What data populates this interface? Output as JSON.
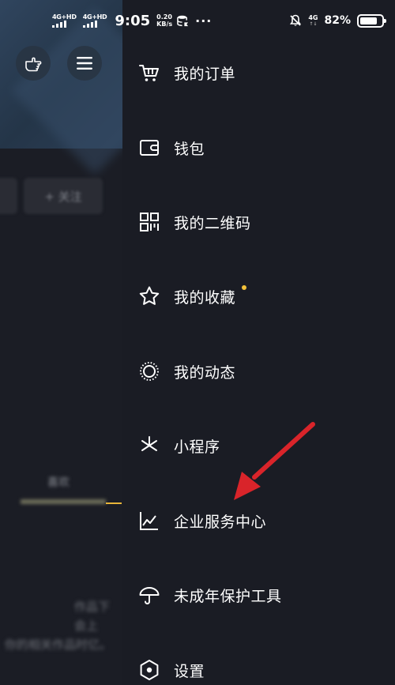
{
  "status_bar": {
    "signal1_tag": "4G+HD",
    "signal2_tag": "4G+HD",
    "time": "9:05",
    "speed_value": "0.20",
    "speed_unit": "KB/s",
    "more": "···",
    "net_type_top": "4G",
    "net_type_bottom": "↑↓",
    "battery_percent": "82%",
    "battery_level": 0.82
  },
  "background_page": {
    "follow_button_label": "+ 关注",
    "tab_label": "喜欢",
    "tab_dim_label": "",
    "blurred_text_line1": "作品下会上",
    "blurred_text_line2": "你的相关作品时亿。"
  },
  "menu": {
    "items": [
      {
        "id": "orders",
        "label": "我的订单",
        "icon": "cart-icon"
      },
      {
        "id": "wallet",
        "label": "钱包",
        "icon": "wallet-icon"
      },
      {
        "id": "qrcode",
        "label": "我的二维码",
        "icon": "qrcode-icon"
      },
      {
        "id": "favorites",
        "label": "我的收藏",
        "icon": "star-icon"
      },
      {
        "id": "moments",
        "label": "我的动态",
        "icon": "dotted-circle-icon"
      },
      {
        "id": "miniprogram",
        "label": "小程序",
        "icon": "asterisk-icon"
      },
      {
        "id": "enterprise",
        "label": "企业服务中心",
        "icon": "line-chart-icon"
      },
      {
        "id": "minor",
        "label": "未成年保护工具",
        "icon": "umbrella-icon"
      },
      {
        "id": "settings",
        "label": "设置",
        "icon": "hexagon-settings-icon"
      }
    ]
  },
  "colors": {
    "drawer_bg": "#1a1c24",
    "accent_yellow": "#f3c13a",
    "arrow_red": "#d9242a"
  }
}
